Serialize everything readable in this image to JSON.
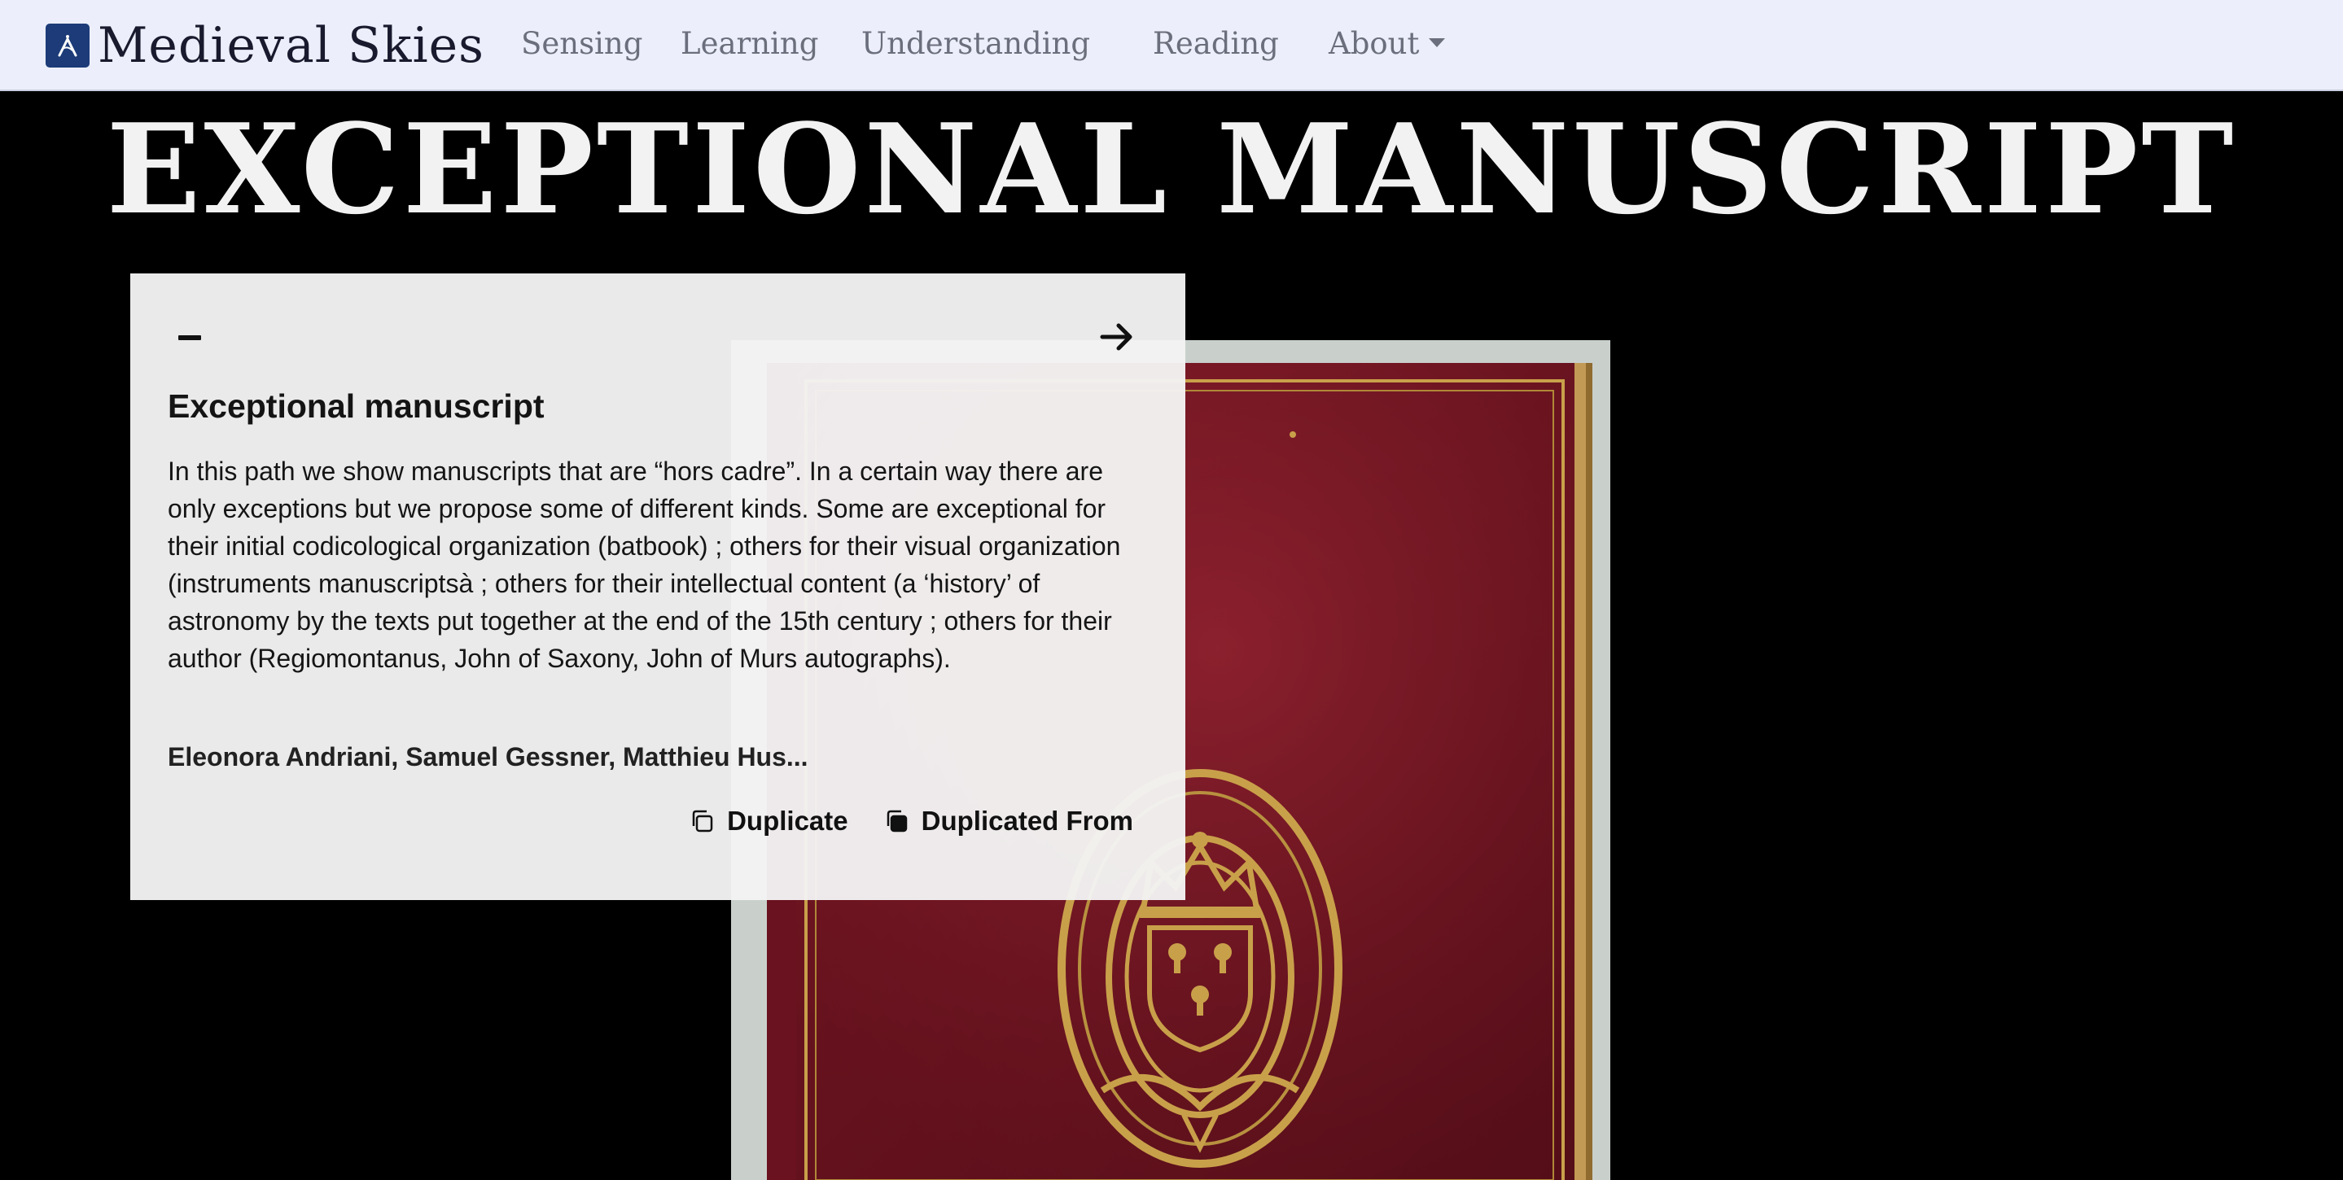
{
  "navbar": {
    "brand": "Medieval Skies",
    "links": [
      "Sensing",
      "Learning",
      "Understanding",
      "Reading",
      "About"
    ]
  },
  "hero": {
    "title": "EXCEPTIONAL MANUSCRIPT"
  },
  "card": {
    "title": "Exceptional manuscript",
    "description": "In this path we show manuscripts that are “hors cadre”. In a certain way there are only exceptions but we propose some of different kinds. Some are exceptional for their initial codicological organization (batbook) ; others for their visual organization (instruments manuscriptsà ; others for their intellectual content (a ‘history’ of astronomy by the texts put together at the end of the 15th century ; others for their author (Regiomontanus, John of Saxony, John of Murs autographs).",
    "authors": "Eleonora Andriani, Samuel Gessner, Matthieu Hus...",
    "duplicate_label": "Duplicate",
    "duplicated_from_label": "Duplicated From"
  },
  "colors": {
    "navbar_bg": "#eceffb",
    "logo_bg": "#1c3b78",
    "page_bg": "#000000",
    "card_bg": "#f4f4f4",
    "book_red": "#7a1422",
    "gold": "#c9a04a"
  },
  "icons": {
    "logo": "logo-mark",
    "minimize": "minus-icon",
    "next": "arrow-right-icon",
    "duplicate": "copy-icon",
    "duplicated_from": "copy-filled-icon",
    "dropdown": "caret-down-icon"
  }
}
